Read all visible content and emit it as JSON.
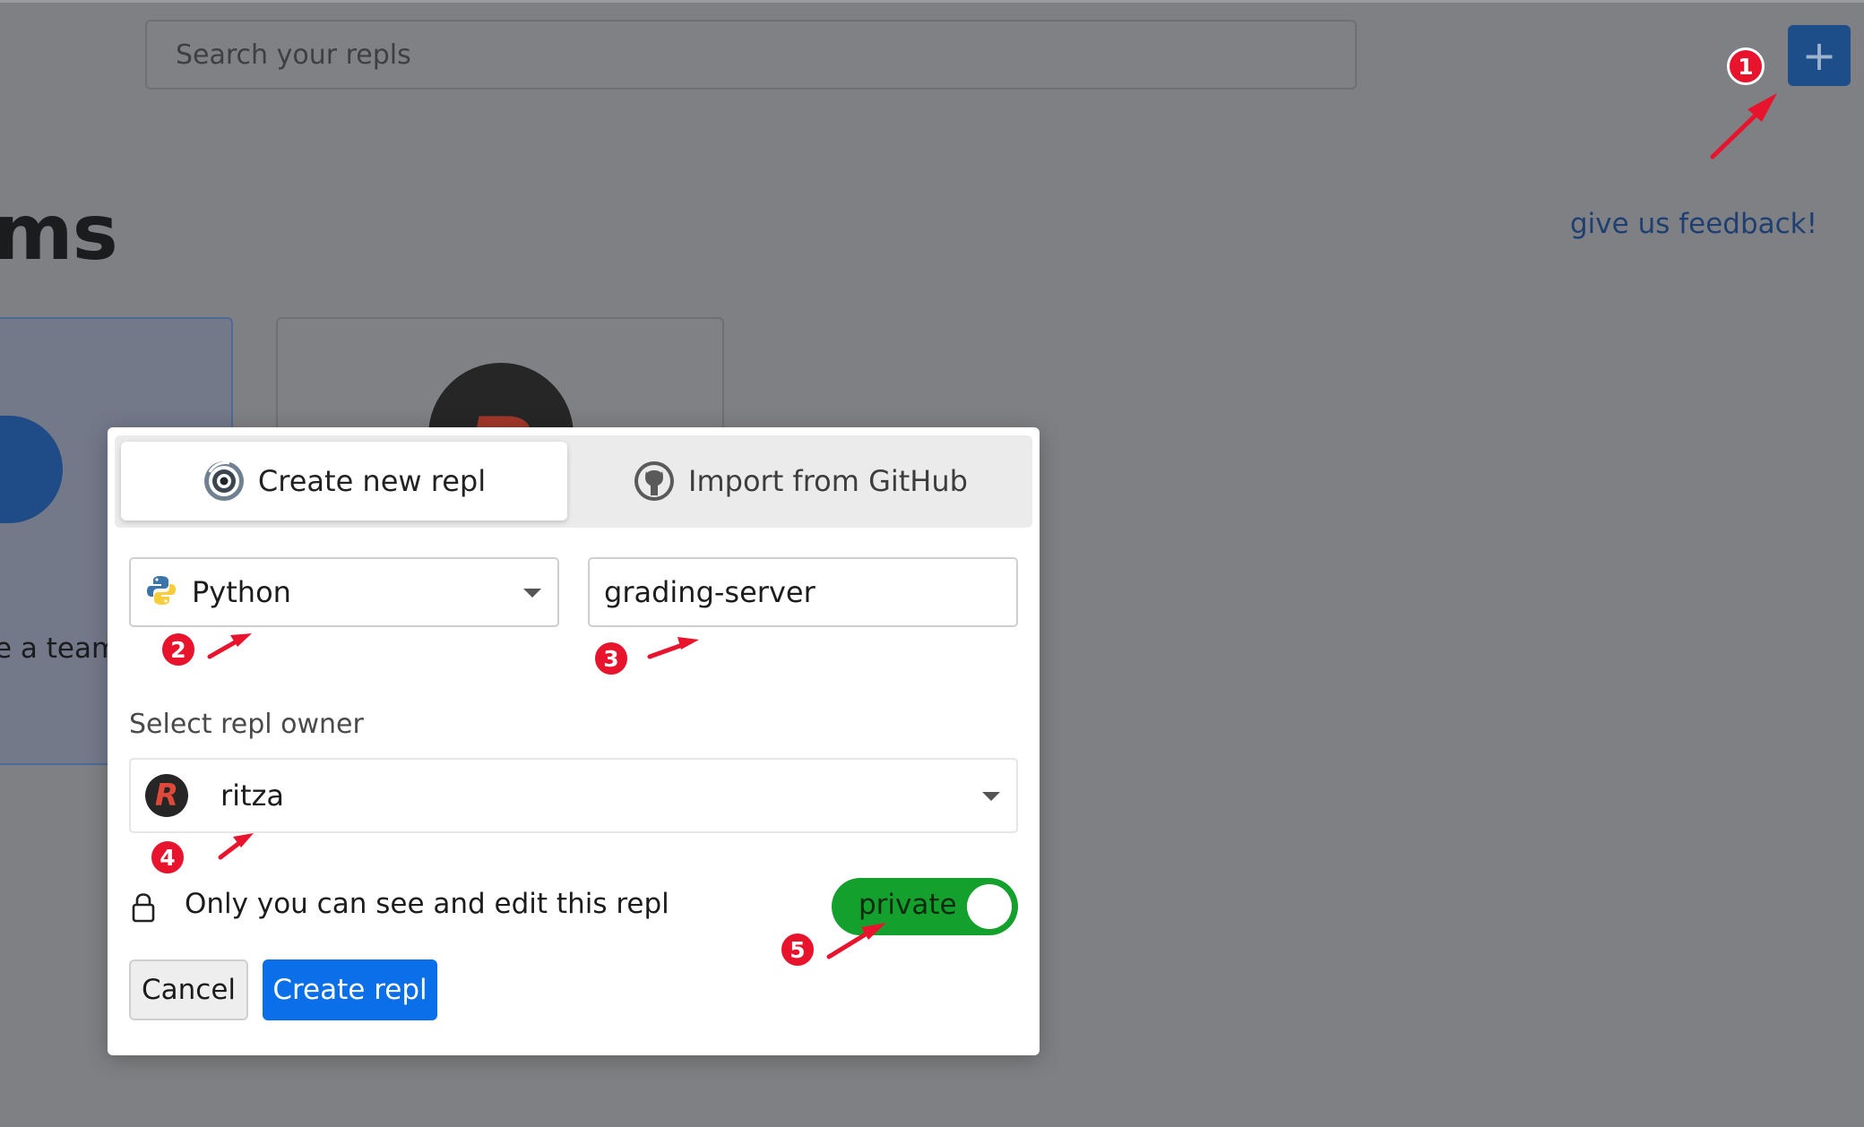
{
  "header": {
    "search_placeholder": "Search your repls",
    "new_repl_label": "+"
  },
  "page": {
    "heading_partial": "ms",
    "feedback_link": "give us feedback!",
    "team_card": {
      "plus_label": "+",
      "label_partial": "e a team",
      "avatar_letter": "R"
    }
  },
  "modal": {
    "tabs": [
      {
        "label": "Create new repl",
        "icon": "replit-logo-icon",
        "active": true
      },
      {
        "label": "Import from GitHub",
        "icon": "github-icon",
        "active": false
      }
    ],
    "language": {
      "value": "Python",
      "icon": "python-icon"
    },
    "repl_name": {
      "value": "grading-server"
    },
    "owner": {
      "label": "Select repl owner",
      "value": "ritza",
      "avatar_letter": "R"
    },
    "privacy": {
      "text": "Only you can see and edit this repl",
      "toggle_label": "private",
      "toggle_on": true,
      "icon": "lock-icon"
    },
    "buttons": {
      "cancel": "Cancel",
      "create": "Create repl"
    }
  },
  "annotations": {
    "color": "#e8132d",
    "labels": [
      "1",
      "2",
      "3",
      "4",
      "5"
    ]
  },
  "colors": {
    "overlay": "#7f8083",
    "primary_button": "#0a6fe8",
    "toggle_on": "#14a02c",
    "link": "#1f3f73"
  }
}
